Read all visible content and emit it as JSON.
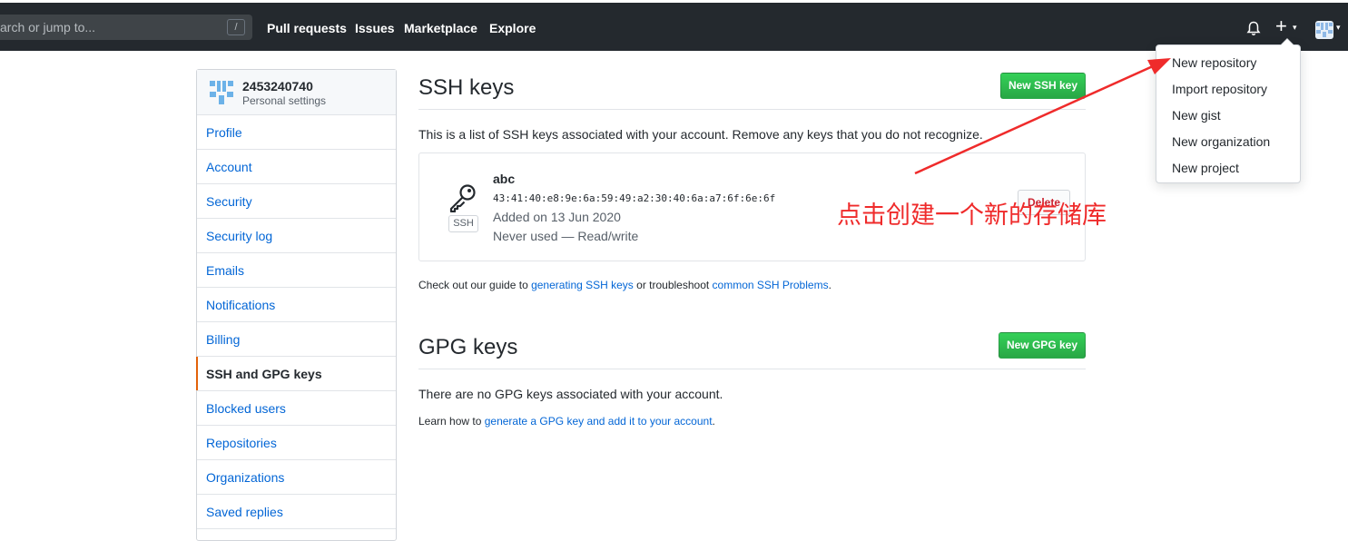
{
  "header": {
    "search_placeholder": "arch or jump to...",
    "search_shortcut": "/",
    "nav": [
      "Pull requests",
      "Issues",
      "Marketplace",
      "Explore"
    ],
    "plus_symbol": "+",
    "caret": "▾"
  },
  "sidebar": {
    "username": "2453240740",
    "subtitle": "Personal settings",
    "items": [
      "Profile",
      "Account",
      "Security",
      "Security log",
      "Emails",
      "Notifications",
      "Billing",
      "SSH and GPG keys",
      "Blocked users",
      "Repositories",
      "Organizations",
      "Saved replies"
    ],
    "active_item": "SSH and GPG keys"
  },
  "ssh": {
    "title": "SSH keys",
    "new_button": "New SSH key",
    "description": "This is a list of SSH keys associated with your account. Remove any keys that you do not recognize.",
    "key": {
      "name": "abc",
      "fingerprint": "43:41:40:e8:9e:6a:59:49:a2:30:40:6a:a7:6f:6e:6f",
      "added": "Added on 13 Jun 2020",
      "usage": "Never used — Read/write",
      "type_label": "SSH",
      "delete_button": "Delete"
    },
    "guide_prefix": "Check out our guide to ",
    "guide_link1": "generating SSH keys",
    "guide_middle": " or troubleshoot ",
    "guide_link2": "common SSH Problems",
    "guide_suffix": "."
  },
  "gpg": {
    "title": "GPG keys",
    "new_button": "New GPG key",
    "empty_text": "There are no GPG keys associated with your account.",
    "learn_prefix": "Learn how to ",
    "learn_link": "generate a GPG key and add it to your account",
    "learn_suffix": "."
  },
  "dropdown": {
    "items": [
      "New repository",
      "Import repository",
      "New gist",
      "New organization",
      "New project"
    ]
  },
  "annotation": {
    "text": "点击创建一个新的存储库",
    "color": "#ef2b2b"
  }
}
